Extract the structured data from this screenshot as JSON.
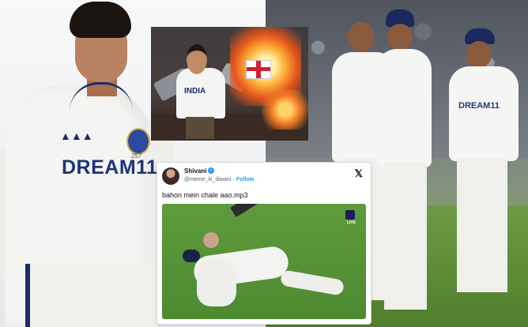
{
  "left_photo": {
    "shirt_sponsor": "DREAM11",
    "crest_number": "257"
  },
  "right_photo": {
    "sponsor_1": "DREAM11",
    "sponsor_2": "DREAM11"
  },
  "meme_image": {
    "shirt_text": "INDIA"
  },
  "tweet": {
    "name": "Shivani",
    "handle": "@meme_ki_diwani",
    "separator": "·",
    "follow_label": "Follow",
    "text": "bahon mein chale aao.mp3",
    "media": {
      "live_label": "LIVE"
    }
  },
  "icons": {
    "verified": "verified-badge-icon",
    "x_logo": "x-logo-icon"
  }
}
